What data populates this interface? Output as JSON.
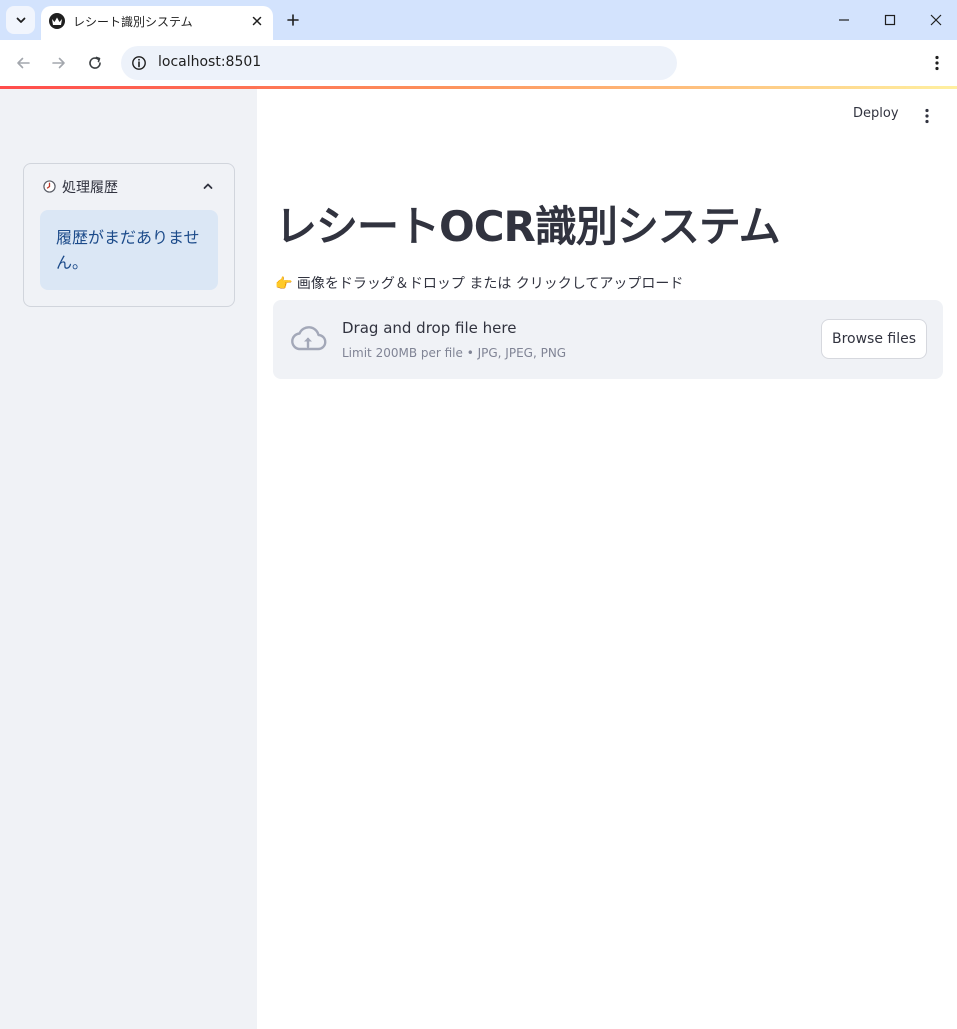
{
  "browser": {
    "tab_title": "レシート識別システム",
    "url": "localhost:8501"
  },
  "sidebar": {
    "expander": {
      "title": "処理履歴",
      "info_message": "履歴がまだありません。"
    }
  },
  "header": {
    "deploy_label": "Deploy"
  },
  "main": {
    "title": "レシートOCR識別システム",
    "upload_label": "👉 画像をドラッグ＆ドロップ または クリックしてアップロード",
    "dropzone": {
      "main_text": "Drag and drop file here",
      "limit_text": "Limit 200MB per file • JPG, JPEG, PNG",
      "browse_label": "Browse files"
    }
  },
  "colors": {
    "sidebar_bg": "#f0f2f6",
    "info_bg": "#dbe7f5",
    "info_text": "#1c4b8a",
    "accent": "#ff4b4b"
  }
}
